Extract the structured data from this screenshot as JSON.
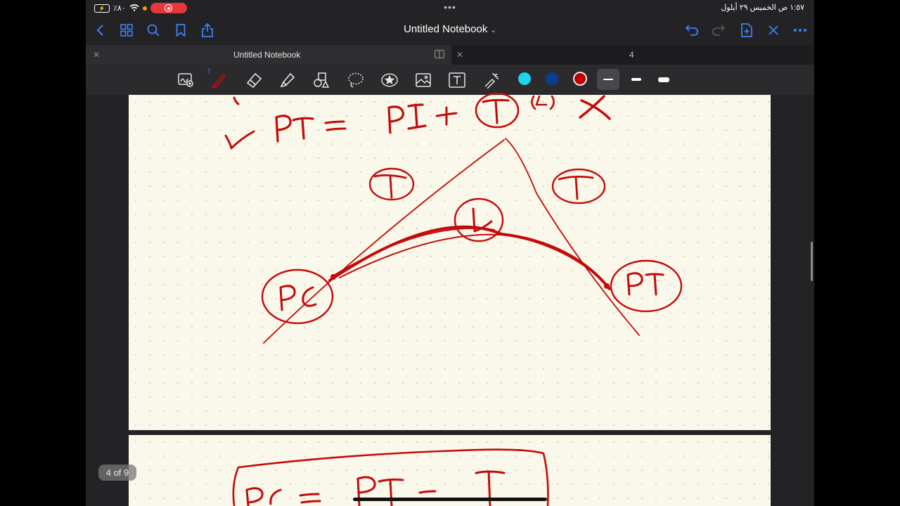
{
  "status_bar": {
    "battery": "٪٨٠",
    "datetime": "١:٥٧ ص   الخميس ٢٩ أيلول"
  },
  "nav": {
    "title": "Untitled Notebook",
    "icons": [
      "back-icon",
      "thumbnails-icon",
      "search-icon",
      "bookmark-icon",
      "share-icon",
      "undo-icon",
      "redo-icon",
      "add-page-icon",
      "close-icon",
      "more-icon"
    ]
  },
  "tabs": [
    {
      "label": "Untitled Notebook",
      "active": true
    },
    {
      "label": "4",
      "active": false
    }
  ],
  "toolbar": {
    "tools": [
      "handwriting-tool-icon",
      "pen-tool-icon",
      "eraser-tool-icon",
      "highlighter-tool-icon",
      "shapes-tool-icon",
      "lasso-tool-icon",
      "sticker-tool-icon",
      "image-tool-icon",
      "text-tool-icon",
      "laser-pointer-icon"
    ],
    "colors": [
      "#22d3ee",
      "#0b3d91",
      "#c00000"
    ]
  },
  "page_indicator": "4 of 9",
  "ink_color": "#c40a0a"
}
